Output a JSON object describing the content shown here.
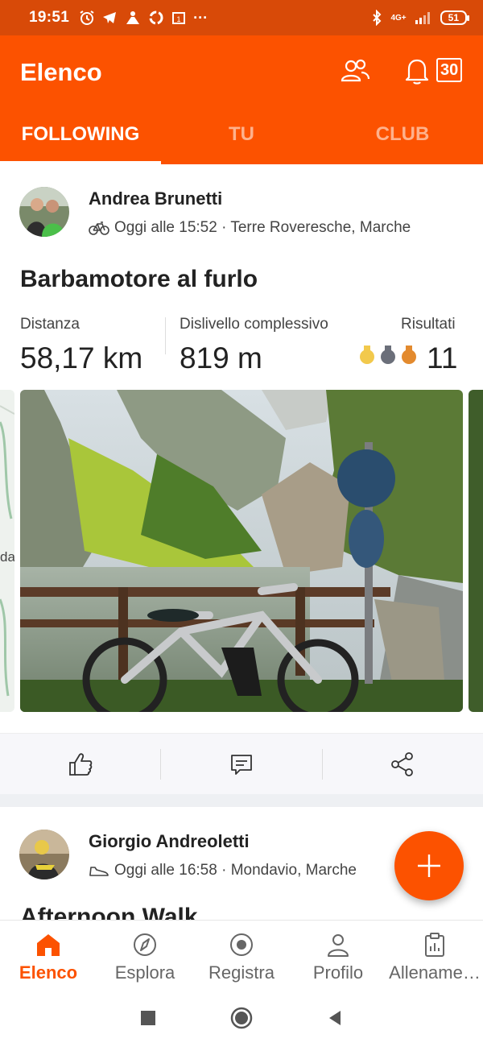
{
  "status_bar": {
    "time": "19:51",
    "icons": [
      "alarm-icon",
      "telegram-icon",
      "strava-icon",
      "sync-icon",
      "calendar-icon",
      "more-icon"
    ],
    "network": "4G+",
    "battery": "51"
  },
  "header": {
    "title": "Elenco",
    "notification_count": "30",
    "tabs": [
      {
        "label": "FOLLOWING",
        "active": true
      },
      {
        "label": "TU",
        "active": false
      },
      {
        "label": "CLUB",
        "active": false
      }
    ]
  },
  "feed": {
    "posts": [
      {
        "athlete": "Andrea Brunetti",
        "activity_icon": "bike-icon",
        "meta": "Oggi alle 15:52 · Terre Roveresche, Marche",
        "title": "Barbamotore al furlo",
        "stats": [
          {
            "label": "Distanza",
            "value": "58,17 km"
          },
          {
            "label": "Dislivello complessivo",
            "value": "819 m"
          },
          {
            "label": "Risultati",
            "value": "11"
          }
        ],
        "medal_colors": [
          "#f2c94c",
          "#6b6f7a",
          "#e38a2e"
        ],
        "map_peek_text": "da"
      },
      {
        "athlete": "Giorgio Andreoletti",
        "activity_icon": "shoe-icon",
        "meta": "Oggi alle 16:58 · Mondavio, Marche",
        "title": "Afternoon Walk"
      }
    ]
  },
  "bottom_nav": {
    "items": [
      {
        "label": "Elenco",
        "icon": "home-icon",
        "active": true
      },
      {
        "label": "Esplora",
        "icon": "compass-icon",
        "active": false
      },
      {
        "label": "Registra",
        "icon": "record-icon",
        "active": false
      },
      {
        "label": "Profilo",
        "icon": "person-icon",
        "active": false
      },
      {
        "label": "Allename…",
        "icon": "training-log-icon",
        "active": false
      }
    ]
  },
  "colors": {
    "brand": "#fc5200",
    "status_bar": "#d84a08"
  }
}
